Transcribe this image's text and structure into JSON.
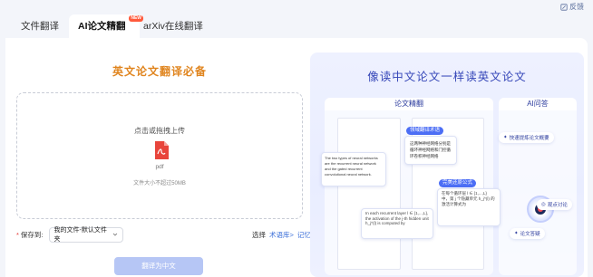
{
  "header": {
    "feedback_label": "反馈"
  },
  "tabs": [
    {
      "label": "文件翻译"
    },
    {
      "label": "AI论文精翻",
      "badge": "NEW"
    },
    {
      "label": "arXiv在线翻译"
    }
  ],
  "left": {
    "title": "英文论文翻译必备",
    "upload_hint": "点击或拖拽上传",
    "file_type": "pdf",
    "size_hint": "文件大小不超过50MB",
    "save_label": "保存到:",
    "save_value": "我的文件-默认文件夹",
    "choose_label": "选择",
    "term_lib": "术语库>",
    "memory_lib": "记忆库>",
    "translate_button": "翻译为中文"
  },
  "right": {
    "title": "像读中文论文一样读英文论文",
    "col1_head": "论文精翻",
    "col2_head": "AI问答",
    "pill_terms": "领域翻译术语",
    "pill_formula": "完美还原公式",
    "en_para": "The two types of neural networks are the recurrent neural network and the gated recurrent convolutional neural network.",
    "zh_para": "这两种神经网络分别是循环神经网络和门控循环卷积神经网络",
    "en_formula_text": "In each recurrent layer l ∈ {1,...,L}, the activation of the j-th hidden unit h_j^(l) is computed by",
    "zh_formula_text": "在每个循环层 l ∈ {1,...,L} 中，第 j 个隐藏单元 h_j^(l) 的激活计算式为",
    "chip_summary": "快速提炼论文概要",
    "chip_discuss": "观点讨论",
    "chip_answer": "论文答疑"
  }
}
